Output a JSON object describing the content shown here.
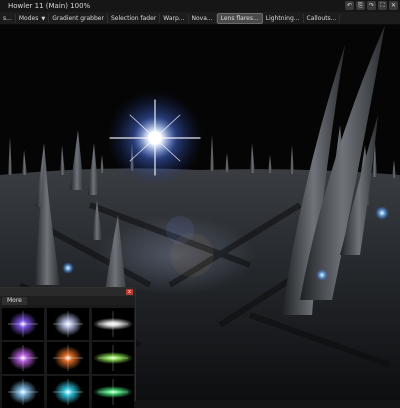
{
  "window": {
    "title": "Howler 11  (Main)   100%"
  },
  "window_buttons": [
    "↶",
    "⎘",
    "↷",
    "⛶",
    "✕"
  ],
  "menu": {
    "items": [
      {
        "label": "s...",
        "active": false,
        "has_caret": false
      },
      {
        "label": "Modes",
        "active": false,
        "has_caret": true
      },
      {
        "label": "Gradient grabber",
        "active": false,
        "has_caret": false
      },
      {
        "label": "Selection fader",
        "active": false,
        "has_caret": false
      },
      {
        "label": "Warp...",
        "active": false,
        "has_caret": false
      },
      {
        "label": "Nova...",
        "active": false,
        "has_caret": false
      },
      {
        "label": "Lens flares...",
        "active": true,
        "has_caret": false
      },
      {
        "label": "Lightning...",
        "active": false,
        "has_caret": false
      },
      {
        "label": "Callouts...",
        "active": false,
        "has_caret": false
      }
    ]
  },
  "panel": {
    "tab": "More",
    "close_glyph": "x",
    "thumbnails": [
      {
        "name": "purple-flare",
        "color": "#8a5cff"
      },
      {
        "name": "soft-flare",
        "color": "#c9d4ff"
      },
      {
        "name": "streak-flare",
        "color": "#ffffff"
      },
      {
        "name": "magenta-star",
        "color": "#d26bff"
      },
      {
        "name": "orange-glow",
        "color": "#ff7a2a"
      },
      {
        "name": "green-burst",
        "color": "#9cff5a"
      },
      {
        "name": "blue-sparkle",
        "color": "#8fd0ff"
      },
      {
        "name": "cyan-halo",
        "color": "#36e0ff"
      },
      {
        "name": "green-ring",
        "color": "#4dff88"
      }
    ]
  },
  "colors": {
    "flare": "#ffffff",
    "flare_glow": "#5b8cff",
    "ground": "#2c2f33",
    "sky": "#050505"
  }
}
